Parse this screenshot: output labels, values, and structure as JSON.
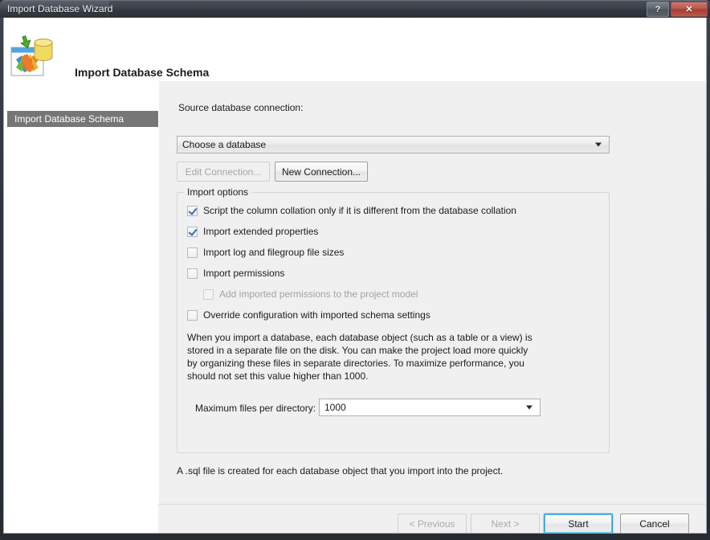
{
  "window": {
    "title": "Import Database Wizard",
    "help_button": "?",
    "close_button": "✕"
  },
  "header": {
    "title": "Import Database Schema",
    "icon": "import-database-icon"
  },
  "sidebar": {
    "items": [
      {
        "label": "Import Database Schema",
        "selected": true
      }
    ]
  },
  "main": {
    "source_label": "Source database connection:",
    "database_combo": {
      "value": "Choose a database",
      "placeholder": "Choose a database"
    },
    "edit_connection_label": "Edit Connection...",
    "new_connection_label": "New Connection...",
    "group_title": "Import options",
    "options": [
      {
        "label": "Script the column collation only if it is different from the database collation",
        "checked": true,
        "disabled": false,
        "indent": false
      },
      {
        "label": "Import extended properties",
        "checked": true,
        "disabled": false,
        "indent": false
      },
      {
        "label": "Import log and filegroup file sizes",
        "checked": false,
        "disabled": false,
        "indent": false
      },
      {
        "label": "Import permissions",
        "checked": false,
        "disabled": false,
        "indent": false
      },
      {
        "label": "Add imported permissions to the project model",
        "checked": false,
        "disabled": true,
        "indent": true
      },
      {
        "label": "Override configuration with imported schema settings",
        "checked": false,
        "disabled": false,
        "indent": false
      }
    ],
    "help_text": "When you import a database, each database object (such as a table or a view) is stored in a separate file on the disk. You can make the project load more quickly by organizing these files in separate directories. To maximize performance, you should not set this value higher than 1000.",
    "max_files_label": "Maximum files per directory:",
    "max_files_value": "1000",
    "footnote": "A .sql file is created for each database object that you import into the project."
  },
  "footer": {
    "previous_label": "< Previous",
    "next_label": "Next >",
    "start_label": "Start",
    "cancel_label": "Cancel"
  },
  "colors": {
    "titlebar": "#323840",
    "content_bg": "#f0f0f0",
    "sidebar_selected": "#767676",
    "default_button_focus": "#2e9ad6",
    "checkmark": "#2f6fb5"
  }
}
